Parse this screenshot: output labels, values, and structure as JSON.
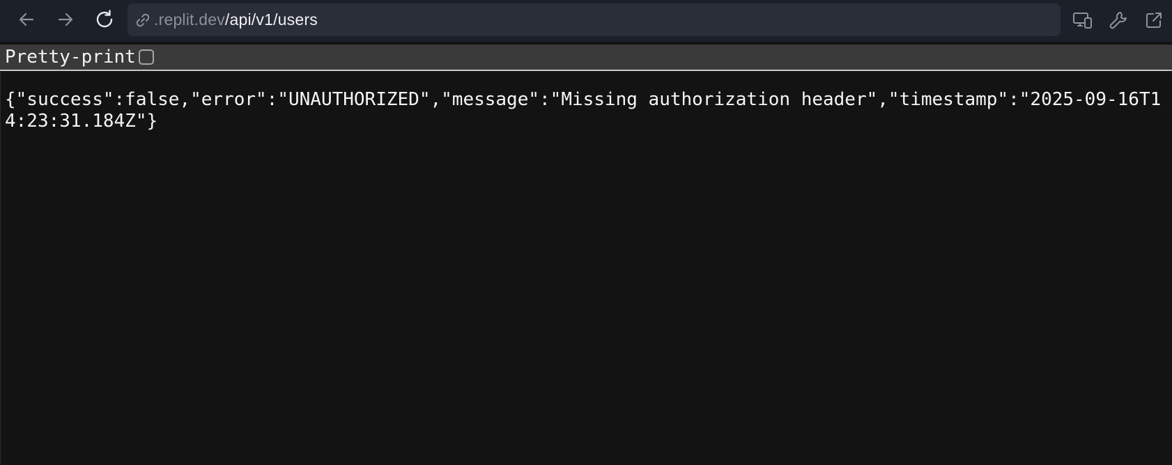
{
  "browser": {
    "url_domain": ".replit.dev",
    "url_path": "/api/v1/users",
    "icons": {
      "back": "arrow-left-icon",
      "forward": "arrow-right-icon",
      "reload": "reload-icon",
      "link": "link-icon",
      "devices": "devices-icon",
      "devtools": "wrench-icon",
      "open_external": "external-link-icon"
    }
  },
  "viewer": {
    "pretty_print_label": "Pretty-print",
    "pretty_print_checked": false,
    "body_text": "{\"success\":false,\"error\":\"UNAUTHORIZED\",\"message\":\"Missing authorization header\",\"timestamp\":\"2025-09-16T14:23:31.184Z\"}"
  },
  "colors": {
    "toolbar_bg": "#1c2029",
    "urlbar_bg": "#2a2e38",
    "page_bg": "#131313",
    "pretty_bar_bg": "#3a3a3a",
    "text": "#f5f5f5"
  }
}
